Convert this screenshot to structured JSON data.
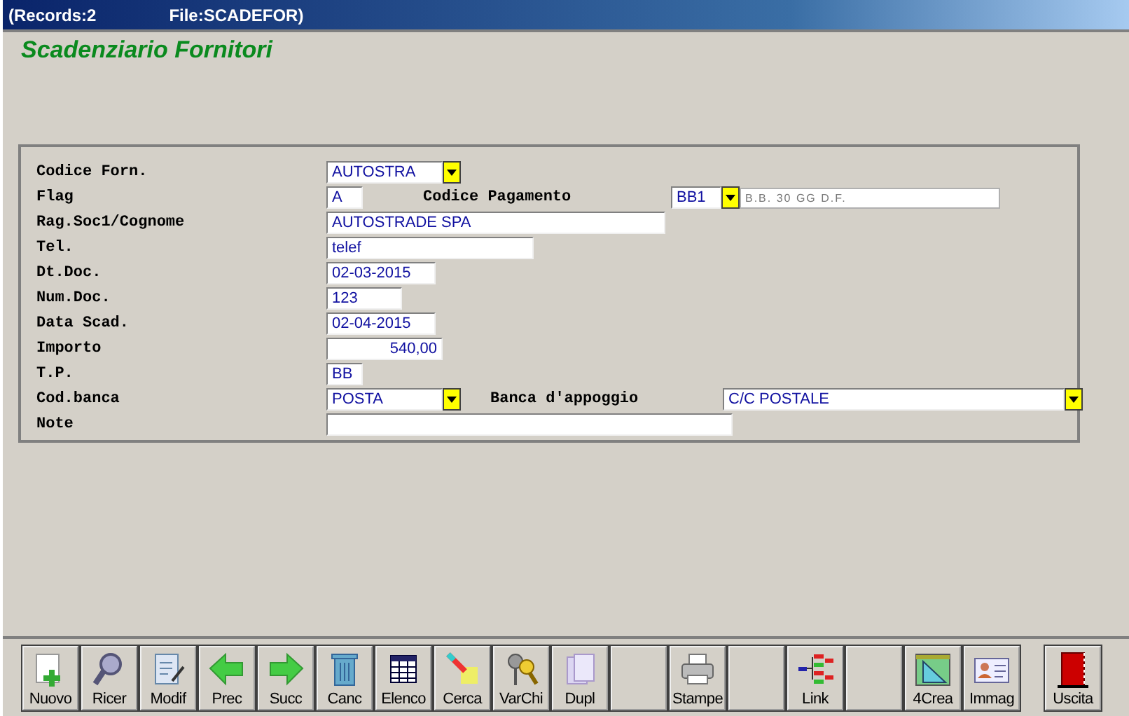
{
  "window": {
    "title_parts": [
      "(Records:2",
      "File:SCADEFOR)"
    ]
  },
  "heading": "Scadenziario Fornitori",
  "fields": [
    {
      "label": "Codice Forn.",
      "kind": "combo",
      "value": "AUTOSTRA"
    },
    {
      "label": "Flag",
      "kind": "text",
      "value": "A",
      "extra": {
        "label": "Codice Pagamento",
        "kind": "combo",
        "value": "BB1",
        "description": "B.B. 30 GG D.F."
      }
    },
    {
      "label": "Rag.Soc1/Cognome",
      "kind": "text",
      "value": "AUTOSTRADE SPA"
    },
    {
      "label": "Tel.",
      "kind": "text",
      "value": "telef"
    },
    {
      "label": "Dt.Doc.",
      "kind": "text",
      "value": "02-03-2015"
    },
    {
      "label": "Num.Doc.",
      "kind": "text",
      "value": "123"
    },
    {
      "label": "Data Scad.",
      "kind": "text",
      "value": "02-04-2015"
    },
    {
      "label": "Importo",
      "kind": "number",
      "value": "540,00"
    },
    {
      "label": "T.P.",
      "kind": "text",
      "value": "BB"
    },
    {
      "label": "Cod.banca",
      "kind": "combo",
      "value": "POSTA",
      "extra": {
        "label": "Banca d'appoggio",
        "kind": "combo",
        "value": "C/C POSTALE"
      }
    },
    {
      "label": "Note",
      "kind": "text"
    }
  ],
  "toolbar": [
    {
      "kind": "button",
      "label": "Nuovo"
    },
    {
      "kind": "button",
      "label": "Ricer"
    },
    {
      "kind": "button",
      "label": "Modif"
    },
    {
      "kind": "button",
      "label": "Prec"
    },
    {
      "kind": "button",
      "label": "Succ"
    },
    {
      "kind": "button",
      "label": "Canc"
    },
    {
      "kind": "button",
      "label": "Elenco"
    },
    {
      "kind": "button",
      "label": "Cerca"
    },
    {
      "kind": "button",
      "label": "VarChi"
    },
    {
      "kind": "button",
      "label": "Dupl"
    },
    {
      "kind": "blank"
    },
    {
      "kind": "button",
      "label": "Stampe"
    },
    {
      "kind": "blank"
    },
    {
      "kind": "button",
      "label": "Link"
    },
    {
      "kind": "blank"
    },
    {
      "kind": "button",
      "label": "4Crea"
    },
    {
      "kind": "button",
      "label": "Immag"
    },
    {
      "kind": "exit",
      "label": "Uscita"
    }
  ]
}
